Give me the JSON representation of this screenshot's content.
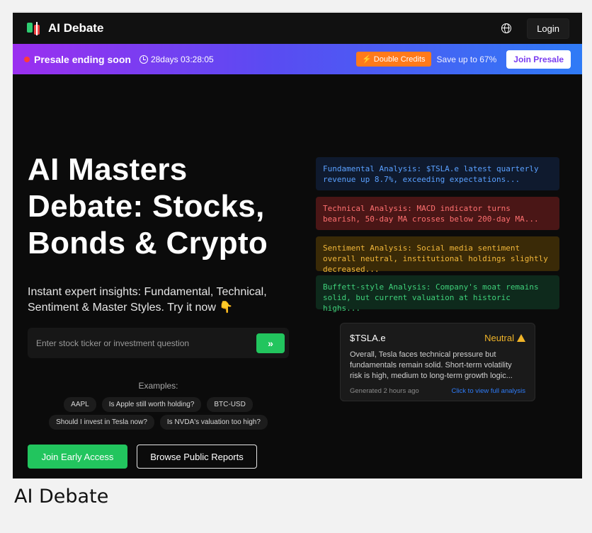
{
  "header": {
    "brand": "AI Debate",
    "login_label": "Login",
    "icons": {
      "logo": "candlestick-logo-icon",
      "language": "globe-icon"
    }
  },
  "promo": {
    "title": "Presale ending soon",
    "countdown": "28days 03:28:05",
    "credit_badge": "⚡ Double Credits",
    "save_text": "Save up to 67%",
    "cta_label": "Join Presale",
    "colors": {
      "gradient_start": "#9b2ff0",
      "gradient_end": "#2f7bf6",
      "badge": "#ff7a1a"
    }
  },
  "hero": {
    "title_lines": [
      "AI Masters",
      "Debate: Stocks,",
      "Bonds & Crypto"
    ],
    "subtitle": "Instant expert insights: Fundamental, Technical, Sentiment & Master Styles. Try it now 👇",
    "search": {
      "placeholder": "Enter stock ticker or investment question",
      "submit_label": "»"
    },
    "examples_label": "Examples:",
    "examples_row1": [
      "AAPL",
      "Is Apple still worth holding?",
      "BTC-USD"
    ],
    "examples_row2": [
      "Should I invest in Tesla now?",
      "Is NVDA's valuation too high?"
    ],
    "cta_primary": "Join Early Access",
    "cta_secondary": "Browse Public Reports"
  },
  "analyses": [
    {
      "text": "Fundamental Analysis: $TSLA.e latest quarterly revenue up 8.7%, exceeding expectations..."
    },
    {
      "text": "Technical Analysis: MACD indicator turns bearish, 50-day MA crosses below 200-day MA..."
    },
    {
      "text": "Sentiment Analysis: Social media sentiment overall neutral, institutional holdings slightly decreased..."
    },
    {
      "text": "Buffett-style Analysis: Company's moat remains solid, but current valuation at historic highs..."
    }
  ],
  "summary": {
    "ticker": "$TSLA.e",
    "sentiment": "Neutral",
    "body": "Overall, Tesla faces technical pressure but fundamentals remain solid. Short-term volatility risk is high, medium to long-term growth logic...",
    "generated": "Generated 2 hours ago",
    "link": "Click to view full analysis",
    "colors": {
      "sentiment": "#f0b429",
      "link": "#2f7bf6"
    }
  },
  "caption": "AI Debate"
}
